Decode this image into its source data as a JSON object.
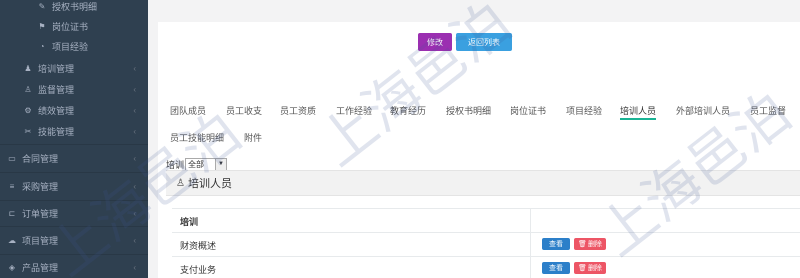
{
  "sidebar": {
    "items": [
      {
        "label": "授权书明细",
        "icon": "tag-icon",
        "level": 1,
        "chevron": ""
      },
      {
        "label": "岗位证书",
        "icon": "certificate-icon",
        "level": 1,
        "chevron": ""
      },
      {
        "label": "项目经验",
        "icon": "project-icon",
        "level": 1,
        "chevron": ""
      },
      {
        "label": "培训管理",
        "icon": "training-icon",
        "level": 0,
        "chevron": "‹"
      },
      {
        "label": "监督管理",
        "icon": "supervise-icon",
        "level": 0,
        "chevron": "‹"
      },
      {
        "label": "绩效管理",
        "icon": "performance-icon",
        "level": 0,
        "chevron": "‹"
      },
      {
        "label": "技能管理",
        "icon": "skill-icon",
        "level": 0,
        "chevron": "‹"
      },
      {
        "label": "合同管理",
        "icon": "contract-icon",
        "level": -1,
        "chevron": "‹"
      },
      {
        "label": "采购管理",
        "icon": "purchase-icon",
        "level": -1,
        "chevron": "‹"
      },
      {
        "label": "订单管理",
        "icon": "order-icon",
        "level": -1,
        "chevron": "‹"
      },
      {
        "label": "项目管理",
        "icon": "project-manage-icon",
        "level": -1,
        "chevron": "‹"
      },
      {
        "label": "产品管理",
        "icon": "product-icon",
        "level": -1,
        "chevron": "‹"
      }
    ]
  },
  "toolbar": {
    "edit_label": "修改",
    "back_label": "返回列表"
  },
  "tabs": [
    {
      "label": "团队成员"
    },
    {
      "label": "员工收支"
    },
    {
      "label": "员工资质"
    },
    {
      "label": "工作经验"
    },
    {
      "label": "教育经历"
    },
    {
      "label": "授权书明细"
    },
    {
      "label": "岗位证书"
    },
    {
      "label": "项目经验"
    },
    {
      "label": "培训人员",
      "active": true
    },
    {
      "label": "外部培训人员"
    },
    {
      "label": "员工监督"
    },
    {
      "label": "员工技能明细"
    },
    {
      "label": "附件"
    }
  ],
  "filter": {
    "label": "培训",
    "selected": "全部"
  },
  "section": {
    "title": "培训人员",
    "icon": "user-icon"
  },
  "table": {
    "header": "培训",
    "rows": [
      {
        "name": "财资概述",
        "view_label": "查看",
        "delete_label": "删除"
      },
      {
        "name": "支付业务",
        "view_label": "查看",
        "delete_label": "删除"
      }
    ]
  },
  "watermark": "上海邑泊"
}
